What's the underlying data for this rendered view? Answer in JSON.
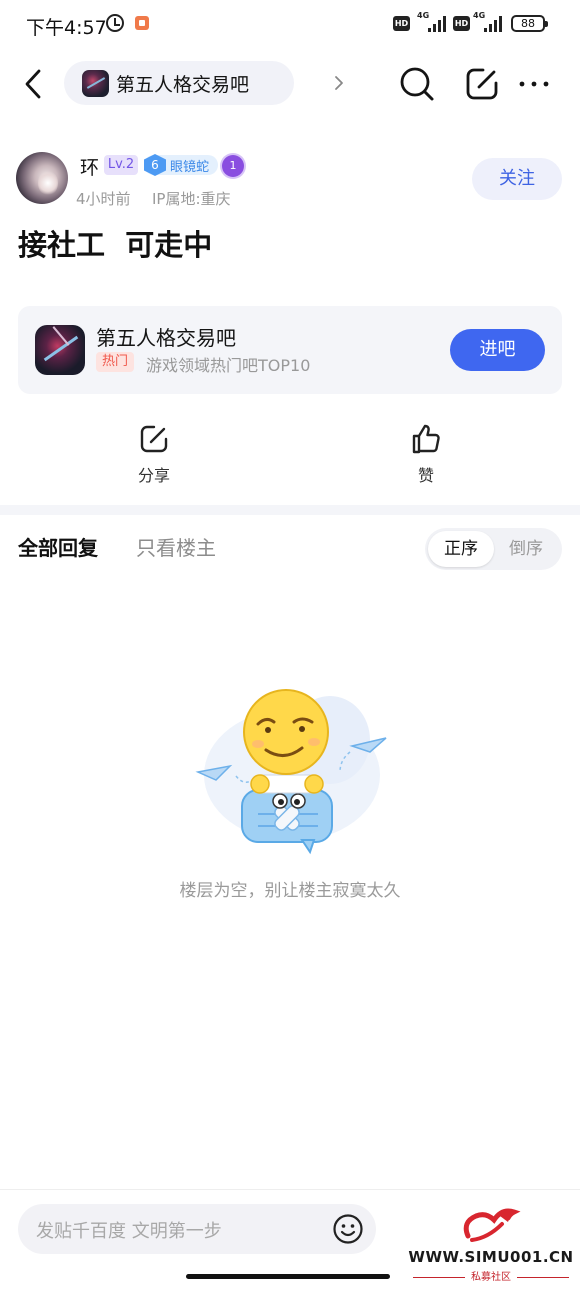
{
  "status_bar": {
    "time": "下午4:57",
    "hd1": "HD",
    "net1": "4G",
    "hd2": "HD",
    "net2": "4G",
    "battery": "88"
  },
  "header": {
    "forum_name": "第五人格交易吧",
    "icons": [
      "back-icon",
      "chevron-right-icon",
      "search-icon",
      "edit-icon",
      "more-icon"
    ]
  },
  "post": {
    "author": {
      "name": "环",
      "level": "Lv.2",
      "fan_level": "6",
      "fan_title": "眼镜蛇",
      "medal": "1"
    },
    "time_ago": "4小时前",
    "ip_location": "IP属地:重庆",
    "follow_label": "关注",
    "title": "接社工  可走中"
  },
  "forum_card": {
    "name": "第五人格交易吧",
    "tag": "热门",
    "description": "游戏领域热门吧TOP10",
    "enter_label": "进吧"
  },
  "actions": {
    "share_label": "分享",
    "like_label": "赞"
  },
  "replies": {
    "tab_all": "全部回复",
    "tab_op": "只看楼主",
    "sort_asc": "正序",
    "sort_desc": "倒序",
    "empty_text": "楼层为空，别让楼主寂寞太久"
  },
  "bottom_bar": {
    "placeholder": "发贴千百度 文明第一步"
  },
  "watermark": {
    "url": "WWW.SIMU001.CN",
    "sub": "私募社区"
  },
  "colors": {
    "accent": "#3f67f0",
    "follow_text": "#3e63e3",
    "hot_tag": "#f0584b",
    "level_badge": "#7356e6"
  }
}
